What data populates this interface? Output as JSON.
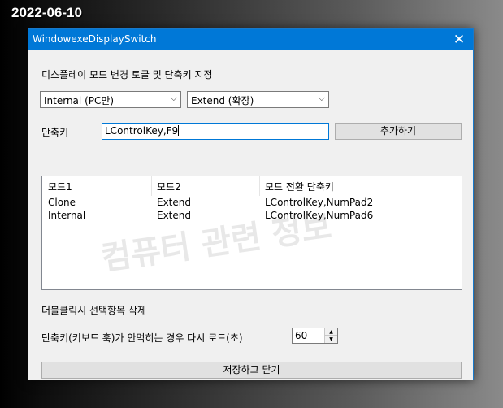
{
  "overlay_date": "2022-06-10",
  "window": {
    "title": "WindowexeDisplaySwitch",
    "close_glyph": "✕"
  },
  "section_label": "디스플레이 모드 변경 토글 및 단축키 지정",
  "mode1_combo": {
    "value": "Internal (PC만)",
    "arrow": "⌵"
  },
  "mode2_combo": {
    "value": "Extend (확장)",
    "arrow": "⌵"
  },
  "hotkey": {
    "label": "단축키",
    "value": "LControlKey,F9",
    "add_button": "추가하기"
  },
  "list": {
    "columns": [
      "모드1",
      "모드2",
      "모드 전환 단축키"
    ],
    "rows": [
      [
        "Clone",
        "Extend",
        "LControlKey,NumPad2"
      ],
      [
        "Internal",
        "Extend",
        "LControlKey,NumPad6"
      ]
    ]
  },
  "watermark": "컴퓨터 관련 정보",
  "double_click_note": "더블클릭시 선택항목 삭제",
  "reload": {
    "label": "단축키(키보드 훅)가 안먹히는 경우 다시 로드(초)",
    "value": "60",
    "up": "▲",
    "down": "▼"
  },
  "save_button": "저장하고 닫기",
  "colors": {
    "titlebar": "#0078d7",
    "window_bg": "#f0f0f0",
    "focus_border": "#0078d7"
  }
}
